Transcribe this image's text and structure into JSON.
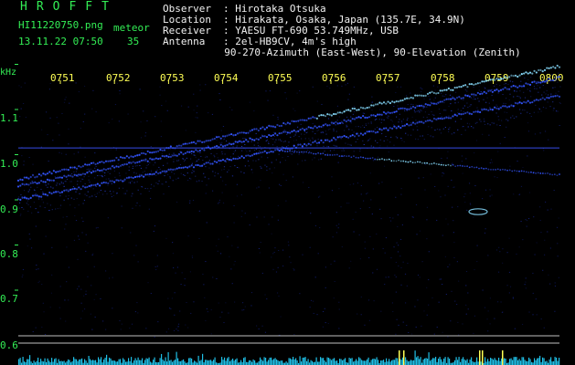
{
  "header": {
    "title": "HROFFT",
    "filename": "HI11220750.png",
    "datetime": "13.11.22 07:50",
    "detection_type": "meteor",
    "count": "35"
  },
  "station": [
    {
      "key": "Observer",
      "value": ": Hirotaka Otsuka"
    },
    {
      "key": "Location",
      "value": ": Hirakata, Osaka, Japan (135.7E, 34.9N)"
    },
    {
      "key": "Receiver",
      "value": ": YAESU FT-690 53.749MHz, USB"
    },
    {
      "key": "Antenna",
      "value": ": 2el-HB9CV, 4m's high"
    },
    {
      "key": "",
      "value": "  90-270-Azimuth (East-West), 90-Elevation (Zenith)"
    }
  ],
  "colors": {
    "background": "#000000",
    "header_text": "#33ee55",
    "info_text": "#f2f2f2",
    "time_labels": "#ffff55",
    "signal": "#3355ff",
    "signal_bright": "#88ddff",
    "baseline_noise": "#22d4ff"
  },
  "chart_data": {
    "type": "heatmap",
    "ylabel": "kHz",
    "yticks": [
      "1.1",
      "1.0",
      "0.9",
      "0.8",
      "0.7",
      "0.6"
    ],
    "xticks": [
      "0751",
      "0752",
      "0753",
      "0754",
      "0755",
      "0756",
      "0757",
      "0758",
      "0759",
      "0800"
    ],
    "yrange": [
      0.58,
      1.14
    ],
    "carrier_line_khz": 0.915,
    "sweep_traces": [
      {
        "from": [
          0,
          0.845
        ],
        "to": [
          1,
          1.095
        ]
      },
      {
        "from": [
          0,
          0.83
        ],
        "to": [
          1,
          1.07
        ]
      },
      {
        "from": [
          0,
          0.8
        ],
        "to": [
          1,
          1.03
        ]
      }
    ],
    "secondary_trace": {
      "from": [
        0.48,
        0.91
      ],
      "to": [
        1,
        0.855
      ]
    }
  }
}
